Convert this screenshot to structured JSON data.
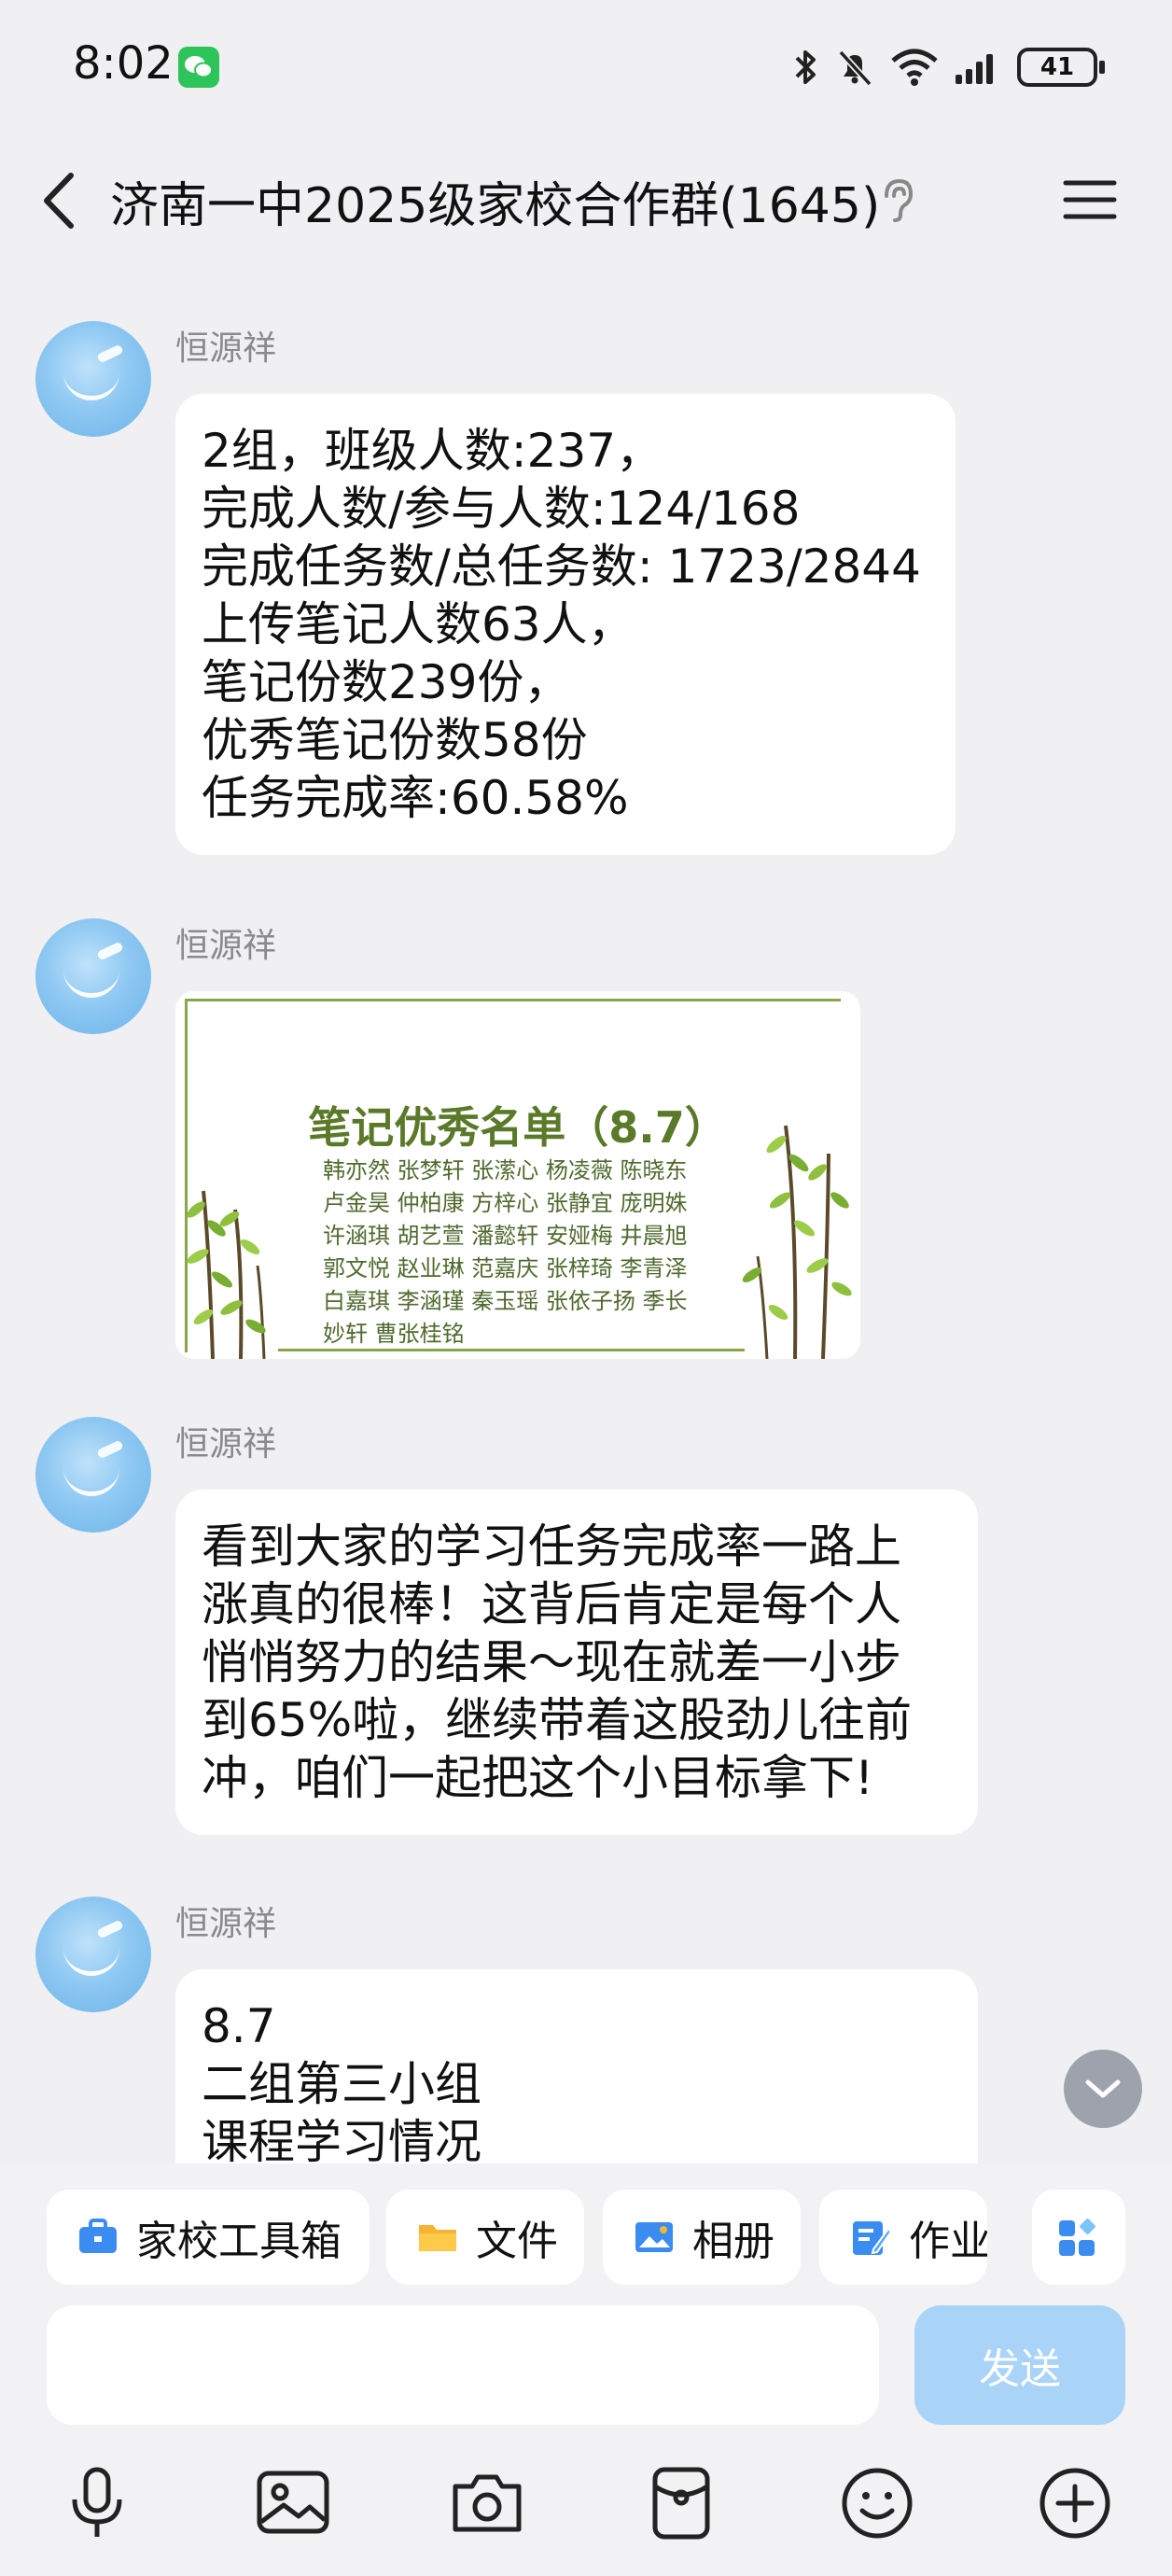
{
  "status_bar": {
    "time": "8:02",
    "battery": "41"
  },
  "header": {
    "title": "济南一中2025级家校合作群(1645)"
  },
  "messages": [
    {
      "sender": "恒源祥",
      "lines": [
        "2组，班级人数:237，",
        "完成人数/参与人数:124/168",
        "完成任务数/总任务数: 1723/2844",
        "上传笔记人数63人，",
        "笔记份数239份，",
        "优秀笔记份数58份",
        "任务完成率:60.58%"
      ]
    },
    {
      "sender": "恒源祥",
      "card": {
        "title": "笔记优秀名单（8.7）",
        "names": [
          "韩亦然 张梦轩 张潆心 杨凌薇 陈晓东",
          "卢金昊 仲柏康 方梓心 张静宜 庞明姝",
          "许涵琪 胡艺萱 潘懿轩 安娅梅 井晨旭",
          "郭文悦 赵业琳 范嘉庆 张梓琦 李青泽",
          "白嘉琪 李涵瑾 秦玉瑶 张依子扬 季长",
          "妙轩 曹张桂铭"
        ]
      }
    },
    {
      "sender": "恒源祥",
      "lines": [
        "看到大家的学习任务完成率一路上",
        "涨真的很棒！这背后肯定是每个人",
        "悄悄努力的结果～现在就差一小步",
        "到65%啦，继续带着这股劲儿往前",
        "冲，咱们一起把这个小目标拿下!"
      ]
    },
    {
      "sender": "恒源祥",
      "lines": [
        "8.7",
        "二组第三小组",
        "课程学习情况"
      ]
    }
  ],
  "toolbar": {
    "tools": [
      {
        "label": "家校工具箱",
        "icon": "toolbox-icon"
      },
      {
        "label": "文件",
        "icon": "folder-icon"
      },
      {
        "label": "相册",
        "icon": "album-icon"
      },
      {
        "label": "作业",
        "icon": "homework-icon"
      }
    ],
    "send_label": "发送"
  },
  "colors": {
    "accent": "#3b8cf0",
    "send_disabled": "#a9d3f7",
    "bubble": "#ffffff",
    "background": "#f0f0f2"
  }
}
